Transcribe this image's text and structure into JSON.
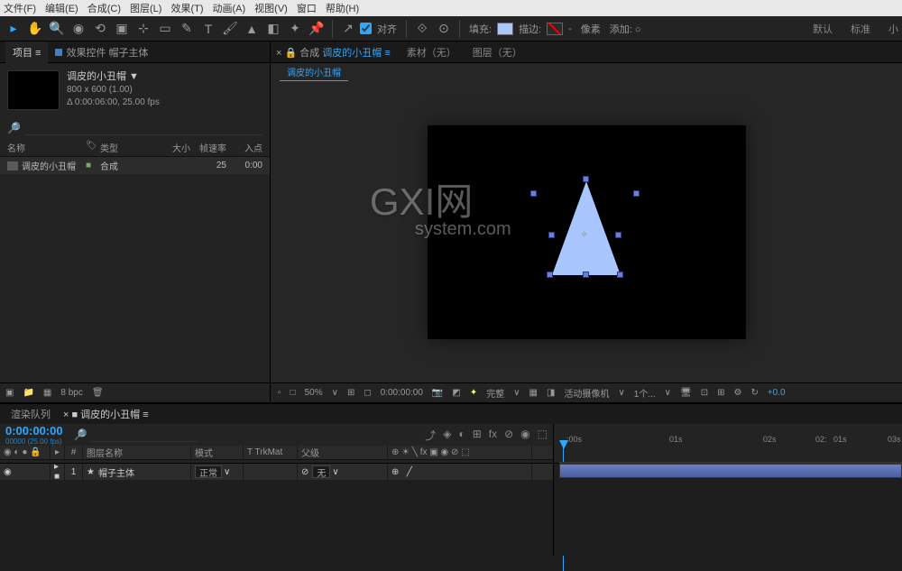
{
  "menubar": [
    "文件(F)",
    "编辑(E)",
    "合成(C)",
    "图层(L)",
    "效果(T)",
    "动画(A)",
    "视图(V)",
    "窗口",
    "帮助(H)"
  ],
  "toolbar": {
    "align": "对齐",
    "fill": "填充:",
    "stroke": "描边:",
    "px": "像素",
    "add": "添加: ○"
  },
  "workspace_tabs": [
    "默认",
    "标准",
    "小"
  ],
  "project": {
    "tab_project": "项目 ≡",
    "tab_effects": "效果控件 帽子主体",
    "comp_name": "调皮的小丑帽 ▼",
    "comp_dims": "800 x 600 (1.00)",
    "comp_dur": "Δ 0:00:06:00, 25.00 fps",
    "col_name": "名称",
    "col_type": "类型",
    "col_size": "大小",
    "col_fps": "帧速率",
    "col_in": "入点",
    "row_name": "调皮的小丑帽",
    "row_type": "合成",
    "row_fps": "25",
    "row_in": "0:00",
    "bpc": "8 bpc"
  },
  "viewer": {
    "tab_comp_prefix": "× 🔒 合成",
    "tab_comp_active": "调皮的小丑帽 ≡",
    "tab_footage": "素材（无）",
    "tab_layer": "图层（无）",
    "subtab": "调皮的小丑帽",
    "footer_zoom": "50%",
    "footer_time": "0:00:00:00",
    "footer_full": "完整",
    "footer_camera": "活动摄像机",
    "footer_views": "1个...",
    "footer_exp": "+0.0"
  },
  "timeline": {
    "tab_render": "渲染队列",
    "tab_comp": "× ■ 调皮的小丑帽 ≡",
    "timecode": "0:00:00:00",
    "timecode_sub": "00000 (25.00 fps)",
    "col_layer": "图层名称",
    "col_mode": "模式",
    "col_trkmat": "T  TrkMat",
    "col_parent": "父级",
    "layer_idx": "1",
    "layer_name": "帽子主体",
    "layer_mode": "正常",
    "layer_parent": "无",
    "ticks": [
      ":00s",
      "01s",
      "02s",
      "02:",
      "01s",
      "03s"
    ],
    "tick_pos": [
      14,
      128,
      232,
      290,
      310,
      370
    ]
  },
  "watermark": {
    "line1": "GXI网",
    "line2": "system.com"
  }
}
